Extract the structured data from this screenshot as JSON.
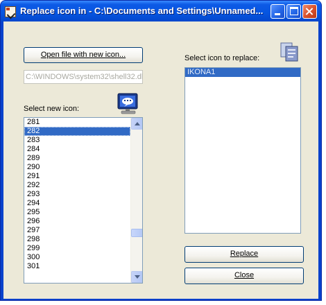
{
  "window": {
    "title": "Replace icon in - C:\\Documents and Settings\\Unnamed..."
  },
  "left": {
    "open_button": "Open file with new icon...",
    "path": "C:\\WINDOWS\\system32\\shell32.dll",
    "select_new_label": "Select new icon:",
    "icons": [
      "281",
      "282",
      "283",
      "284",
      "289",
      "290",
      "291",
      "292",
      "293",
      "294",
      "295",
      "296",
      "297",
      "298",
      "299",
      "300",
      "301"
    ],
    "selected_icon": "282"
  },
  "right": {
    "select_replace_label": "Select icon to replace:",
    "items": [
      "IKONA1"
    ],
    "replace_button": "Replace",
    "close_button": "Close"
  },
  "colors": {
    "titlebar": "#0655e0",
    "selection": "#316ac5",
    "dialog_bg": "#ece9d8"
  },
  "icons": {
    "app": "app-icon",
    "monitor": "monitor-icon",
    "copy": "copy-icon"
  }
}
